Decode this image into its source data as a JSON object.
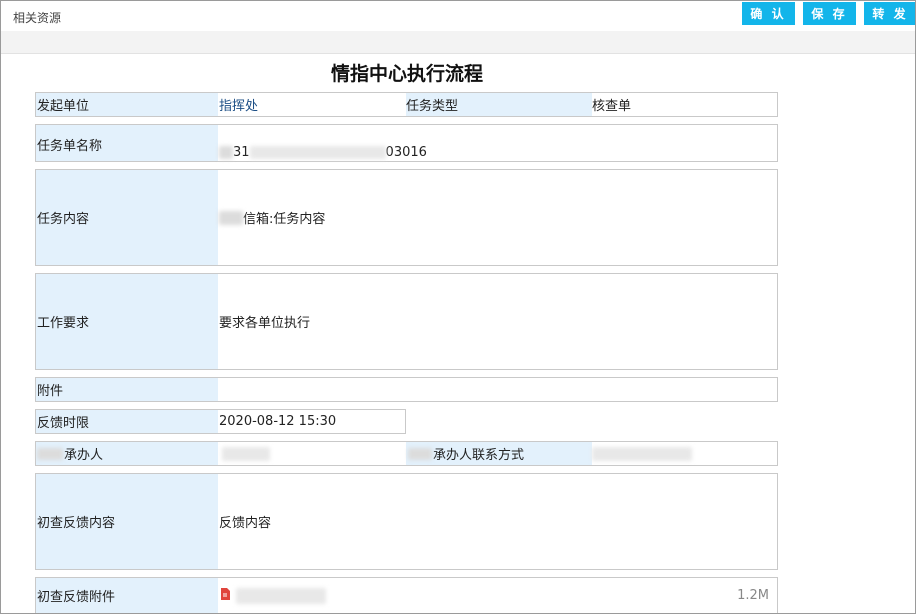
{
  "toolbar": {
    "related_resources": "相关资源",
    "confirm_label": "确 认",
    "save_label": "保 存",
    "forward_label": "转 发"
  },
  "page_title": "情指中心执行流程",
  "form": {
    "initiator_label": "发起单位",
    "initiator_value": "指挥处",
    "task_type_label": "任务类型",
    "task_type_value": "核查单",
    "task_name_label": "任务单名称",
    "task_name_value_prefix": "31",
    "task_name_value_suffix": "03016",
    "task_content_label": "任务内容",
    "task_content_value": "信箱:任务内容",
    "work_requirement_label": "工作要求",
    "work_requirement_value": "要求各单位执行",
    "attachment_label": "附件",
    "feedback_deadline_label": "反馈时限",
    "feedback_deadline_value": "2020-08-12 15:30",
    "handler_label": "承办人",
    "handler_contact_label": "承办人联系方式",
    "initial_feedback_label": "初查反馈内容",
    "initial_feedback_value": "反馈内容",
    "initial_feedback_attachment_label": "初查反馈附件",
    "attachment_file_size": "1.2M"
  },
  "colors": {
    "button_bg": "#13b5ea",
    "label_bg": "#e3f1fc",
    "pdf_icon": "#e0443c"
  },
  "icons": {
    "attachment_file": "pdf-file-icon"
  }
}
